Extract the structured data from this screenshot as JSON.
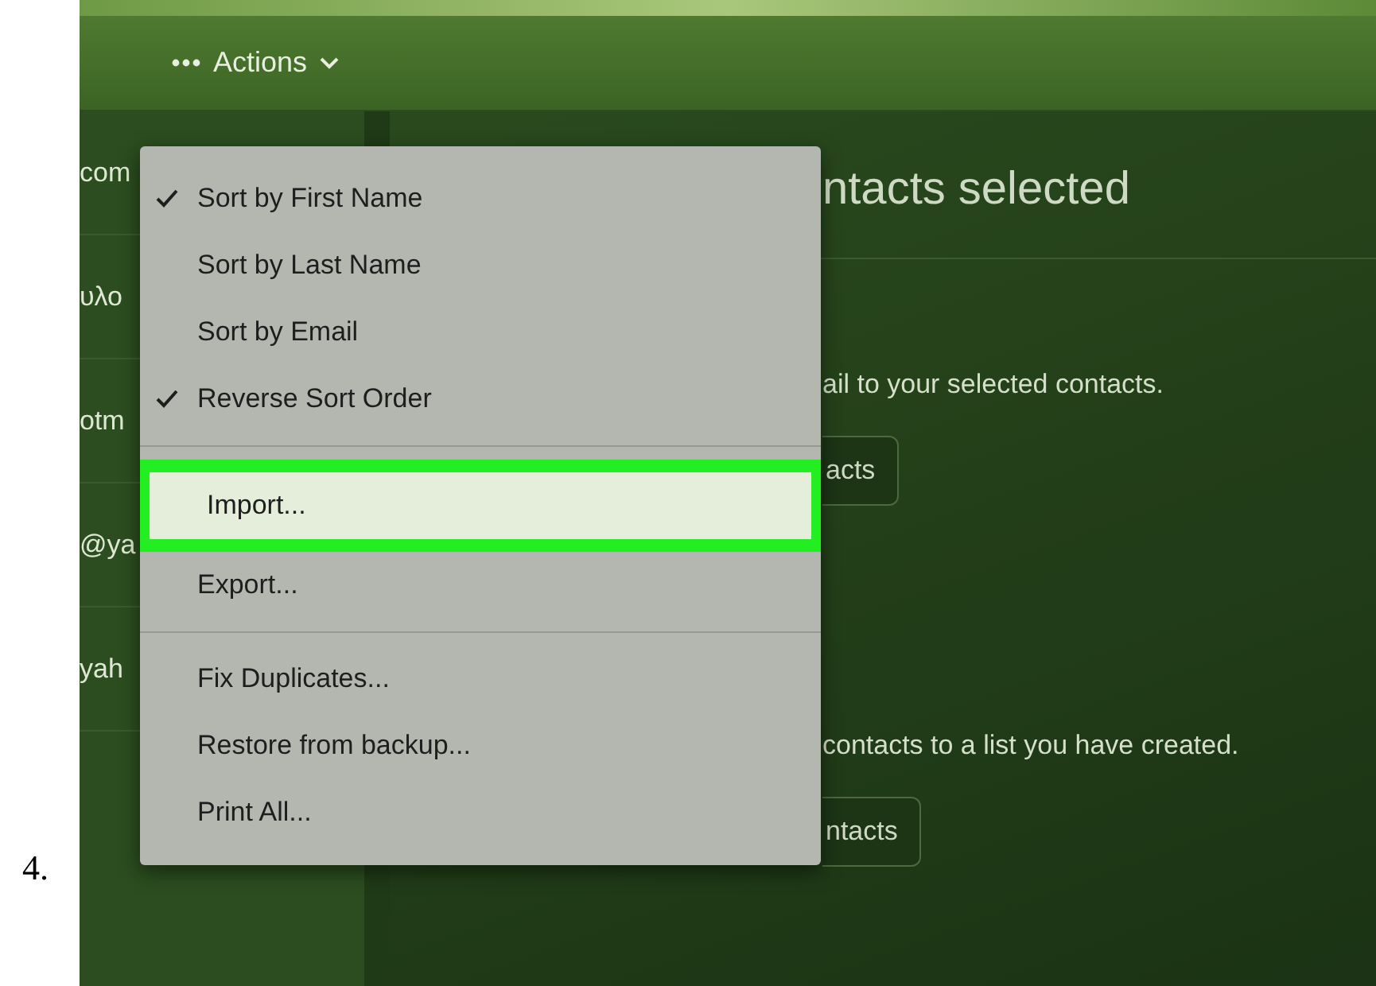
{
  "step_number": "4.",
  "toolbar": {
    "actions_label": "Actions"
  },
  "sidebar": {
    "items": [
      {
        "text": "com"
      },
      {
        "text": "υλο"
      },
      {
        "text": "otm"
      },
      {
        "text": "@ya"
      },
      {
        "text": "yah"
      }
    ]
  },
  "main": {
    "heading": "ntacts selected",
    "sections": [
      {
        "description": "ail to your selected contacts.",
        "button": "acts"
      },
      {
        "description": "contacts to a list you have created.",
        "button": "ntacts"
      }
    ]
  },
  "menu": {
    "items": [
      {
        "kind": "item",
        "label": "Sort by First Name",
        "checked": true,
        "highlighted": false
      },
      {
        "kind": "item",
        "label": "Sort by Last Name",
        "checked": false,
        "highlighted": false
      },
      {
        "kind": "item",
        "label": "Sort by Email",
        "checked": false,
        "highlighted": false
      },
      {
        "kind": "item",
        "label": "Reverse Sort Order",
        "checked": true,
        "highlighted": false
      },
      {
        "kind": "separator"
      },
      {
        "kind": "item",
        "label": "Import...",
        "checked": false,
        "highlighted": true
      },
      {
        "kind": "item",
        "label": "Export...",
        "checked": false,
        "highlighted": false
      },
      {
        "kind": "separator"
      },
      {
        "kind": "item",
        "label": "Fix Duplicates...",
        "checked": false,
        "highlighted": false
      },
      {
        "kind": "item",
        "label": "Restore from backup...",
        "checked": false,
        "highlighted": false
      },
      {
        "kind": "item",
        "label": "Print All...",
        "checked": false,
        "highlighted": false
      }
    ]
  }
}
